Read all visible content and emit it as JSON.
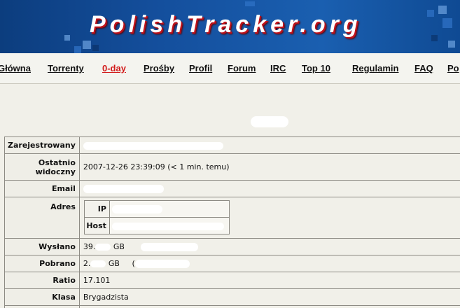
{
  "header": {
    "logo_text": "PolishTracker.org"
  },
  "nav": {
    "items": [
      {
        "label": "Główna"
      },
      {
        "label": "Torrenty"
      },
      {
        "label": "0-day"
      },
      {
        "label": "Prośby"
      },
      {
        "label": "Profil"
      },
      {
        "label": "Forum"
      },
      {
        "label": "IRC"
      },
      {
        "label": "Top 10"
      },
      {
        "label": "Regulamin"
      },
      {
        "label": "FAQ"
      },
      {
        "label": "Po"
      }
    ],
    "active_color": "#d21a1a"
  },
  "profile": {
    "registered": {
      "label": "Zarejestrowany",
      "value": ""
    },
    "last_seen": {
      "label": "Ostatnio widoczny",
      "value": "2007-12-26 23:39:09 (< 1 min. temu)"
    },
    "email": {
      "label": "Email",
      "value": ""
    },
    "address": {
      "label": "Adres",
      "ip_label": "IP",
      "ip_value": "",
      "host_label": "Host",
      "host_value": ""
    },
    "uploaded": {
      "label": "Wysłano",
      "value_prefix": "39.",
      "unit": "GB"
    },
    "downloaded": {
      "label": "Pobrano",
      "value_prefix": "2.",
      "unit": "GB",
      "paren": "("
    },
    "ratio": {
      "label": "Ratio",
      "value": "17.101"
    },
    "class": {
      "label": "Klasa",
      "value": "Brygadzista"
    }
  }
}
